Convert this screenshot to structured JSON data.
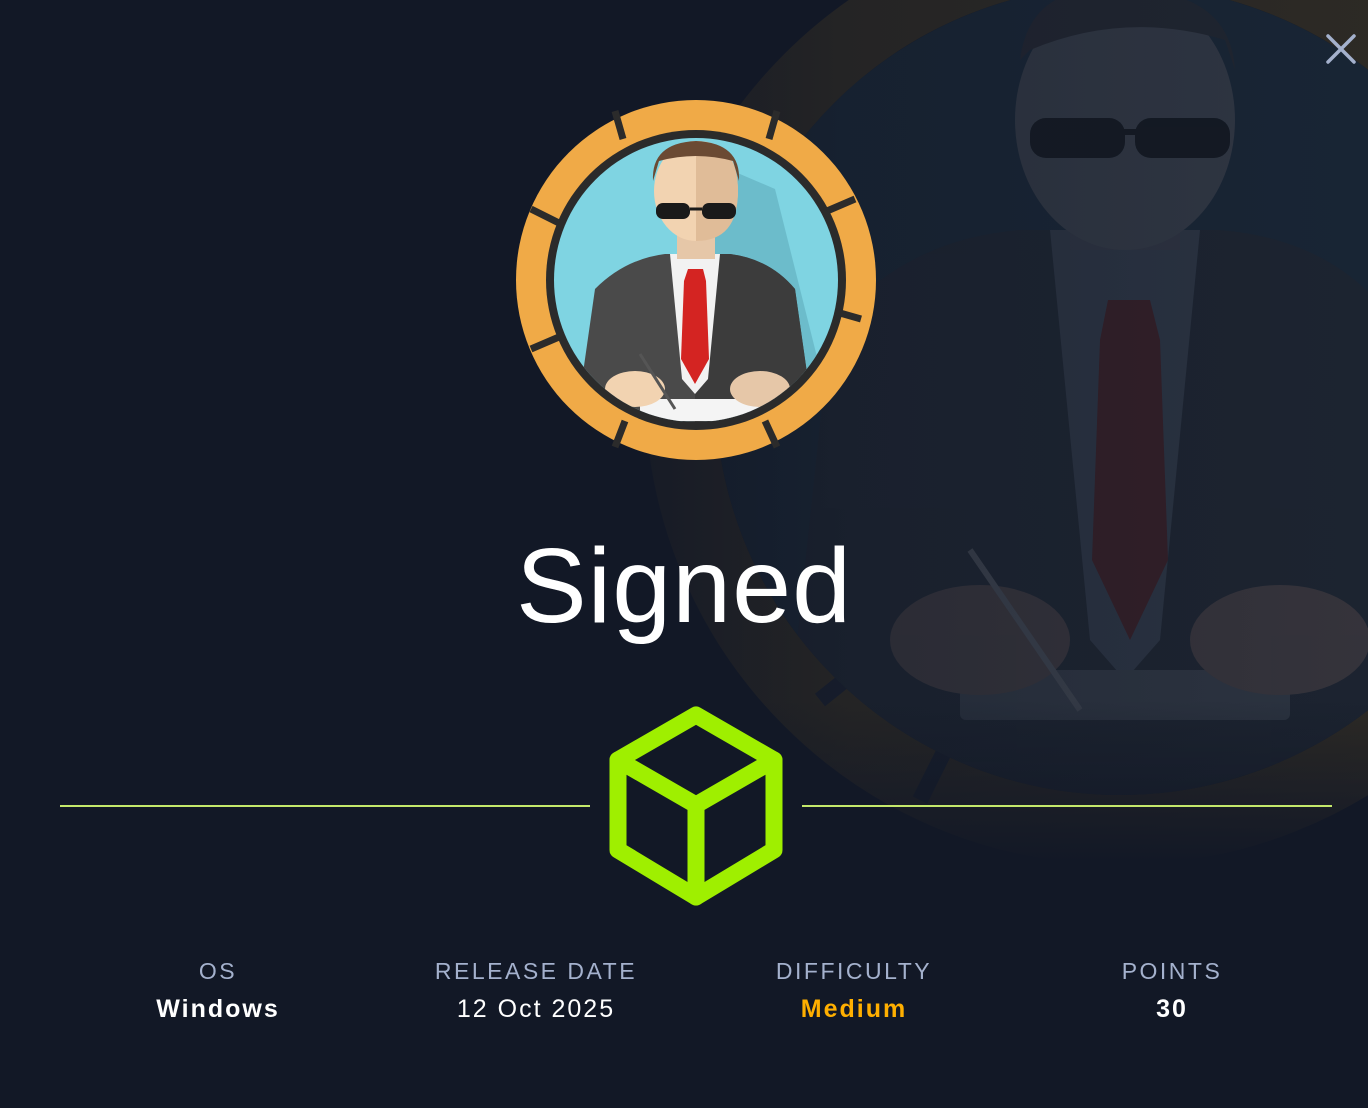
{
  "machine": {
    "name": "Signed"
  },
  "stats": {
    "os": {
      "label": "OS",
      "value": "Windows"
    },
    "release": {
      "label": "RELEASE DATE",
      "value": "12 Oct 2025"
    },
    "difficulty": {
      "label": "DIFFICULTY",
      "value": "Medium",
      "color": "#ffaf00"
    },
    "points": {
      "label": "POINTS",
      "value": "30"
    }
  },
  "icons": {
    "close": "close-icon",
    "avatar": "businessman-signing-avatar",
    "box": "box-icon"
  },
  "colors": {
    "background": "#121826",
    "accent": "#9fef00",
    "divider": "#c4e86b",
    "ring": "#f0aa47"
  }
}
